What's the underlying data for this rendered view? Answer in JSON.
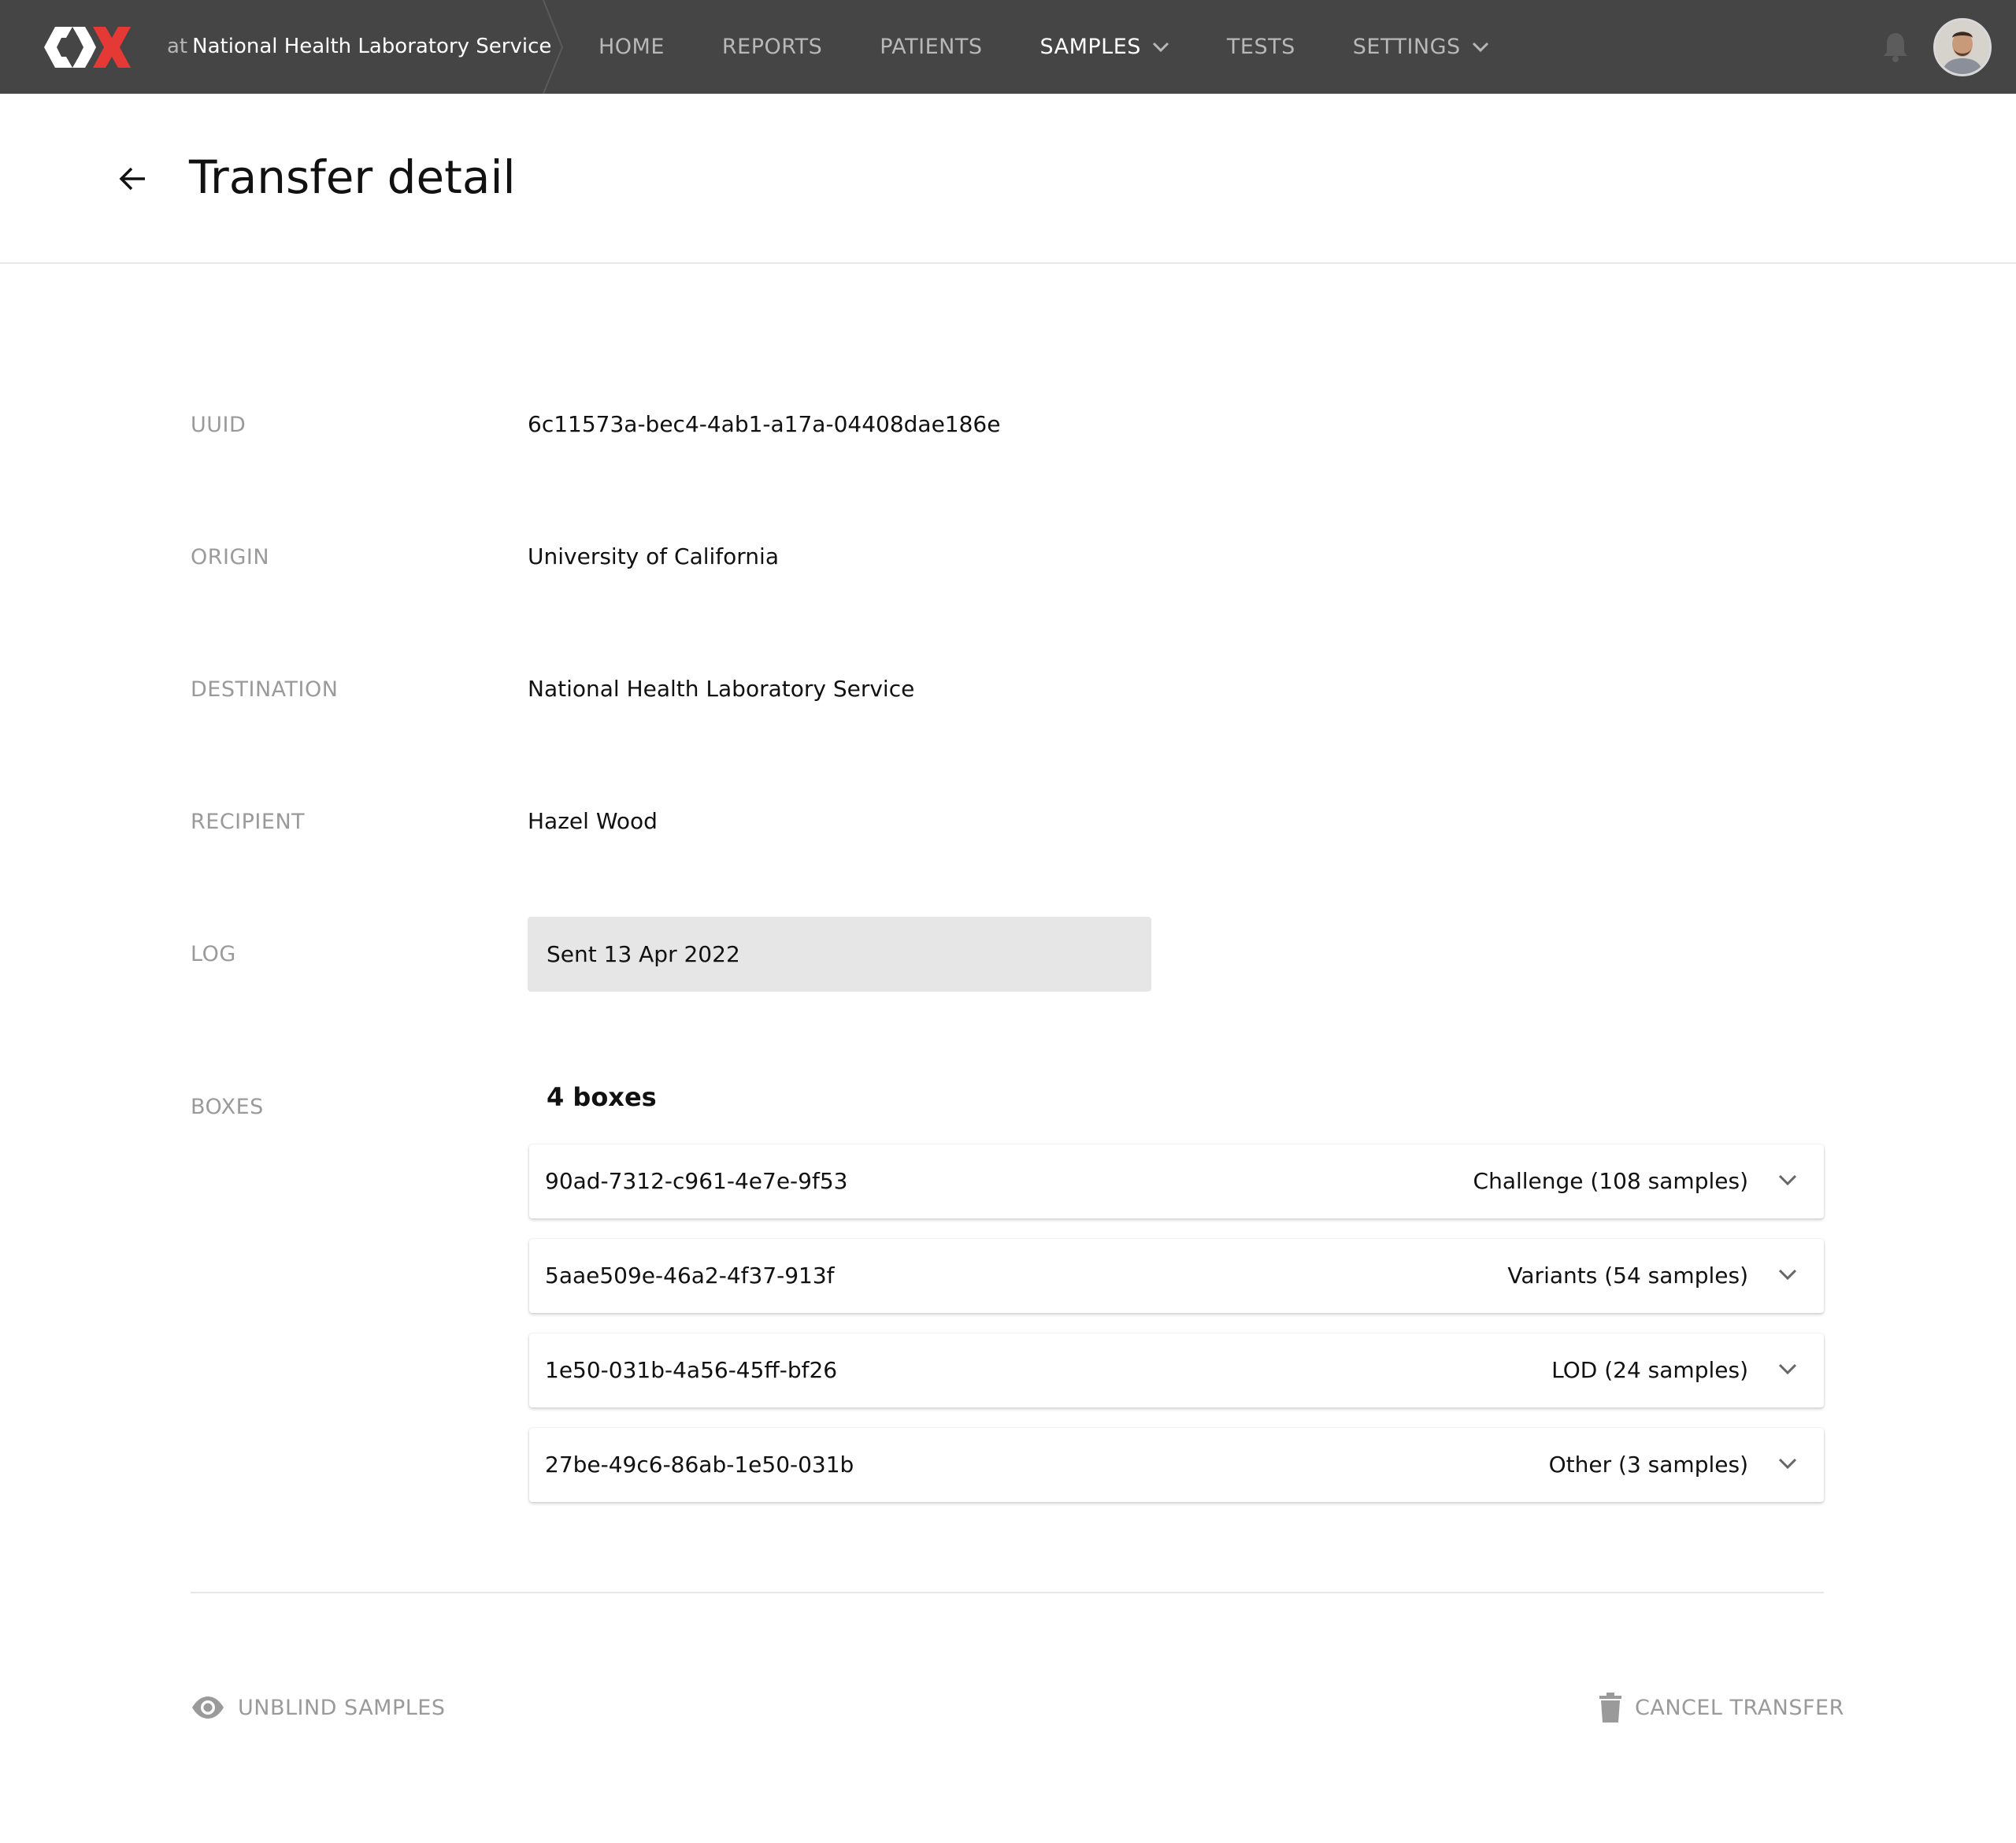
{
  "header": {
    "logo_icon": "cdx-logo-icon",
    "institution_prefix": "at",
    "institution_name": "National Health Laboratory Service",
    "nav": [
      {
        "label": "HOME",
        "active": false,
        "dropdown": false
      },
      {
        "label": "REPORTS",
        "active": false,
        "dropdown": false
      },
      {
        "label": "PATIENTS",
        "active": false,
        "dropdown": false
      },
      {
        "label": "SAMPLES",
        "active": true,
        "dropdown": true
      },
      {
        "label": "TESTS",
        "active": false,
        "dropdown": false
      },
      {
        "label": "SETTINGS",
        "active": false,
        "dropdown": true
      }
    ],
    "notification_icon": "bell-icon",
    "avatar_icon": "user-avatar"
  },
  "page": {
    "back_icon": "arrow-left-icon",
    "title": "Transfer detail"
  },
  "details": {
    "uuid_label": "UUID",
    "uuid_value": "6c11573a-bec4-4ab1-a17a-04408dae186e",
    "origin_label": "ORIGIN",
    "origin_value": "University of California",
    "destination_label": "DESTINATION",
    "destination_value": "National Health Laboratory Service",
    "recipient_label": "RECIPIENT",
    "recipient_value": "Hazel Wood",
    "log_label": "LOG",
    "log_value": "Sent 13 Apr 2022",
    "boxes_label": "BOXES",
    "boxes_count": "4 boxes"
  },
  "boxes": [
    {
      "id": "90ad-7312-c961-4e7e-9f53",
      "type": "Challenge (108 samples)"
    },
    {
      "id": "5aae509e-46a2-4f37-913f",
      "type": "Variants (54 samples)"
    },
    {
      "id": "1e50-031b-4a56-45ff-bf26",
      "type": "LOD (24 samples)"
    },
    {
      "id": "27be-49c6-86ab-1e50-031b",
      "type": "Other (3 samples)"
    }
  ],
  "actions": {
    "unblind_label": "UNBLIND SAMPLES",
    "unblind_icon": "eye-icon",
    "cancel_label": "CANCEL TRANSFER",
    "cancel_icon": "trash-icon"
  },
  "colors": {
    "topbar": "#454545",
    "logo_accent": "#e53935",
    "muted_text": "#9a9a9a",
    "log_bg": "#e6e6e6"
  }
}
